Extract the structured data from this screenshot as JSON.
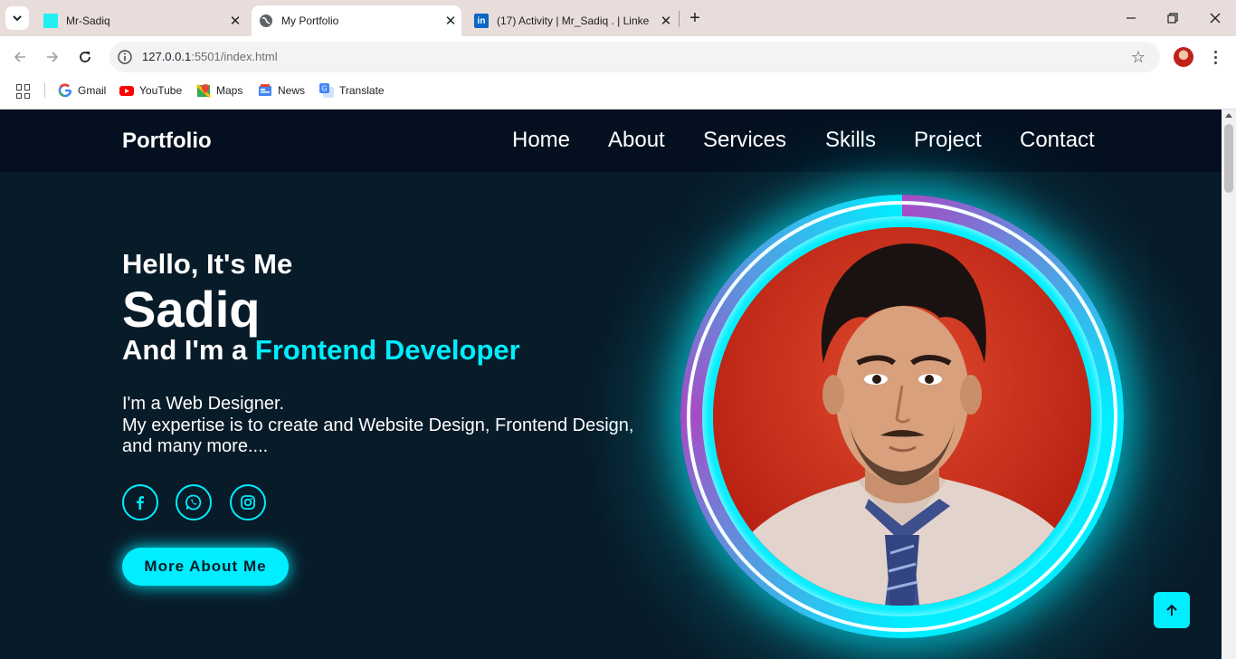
{
  "browser": {
    "tabs": [
      {
        "title": "Mr-Sadiq",
        "icon": "cyan-square-favicon",
        "active": false
      },
      {
        "title": "My Portfolio",
        "icon": "globe-icon",
        "active": true
      },
      {
        "title": "(17) Activity | Mr_Sadiq . | Linke",
        "icon": "linkedin-icon",
        "active": false
      }
    ],
    "new_tab_label": "+",
    "url_host": "127.0.0.1",
    "url_rest": ":5501/index.html",
    "bookmarks": [
      {
        "label": "Gmail",
        "icon": "google-icon"
      },
      {
        "label": "YouTube",
        "icon": "youtube-icon"
      },
      {
        "label": "Maps",
        "icon": "maps-icon"
      },
      {
        "label": "News",
        "icon": "news-icon"
      },
      {
        "label": "Translate",
        "icon": "translate-icon"
      }
    ]
  },
  "site": {
    "logo": "Portfolio",
    "nav": [
      "Home",
      "About",
      "Services",
      "Skills",
      "Project",
      "Contact"
    ],
    "hero": {
      "greeting": "Hello, It's Me",
      "name": "Sadiq",
      "role_prefix": "And I'm a",
      "role": "Frontend Developer",
      "desc_line1": "I'm a Web Designer.",
      "desc_line2": "My expertise is to create and Website Design, Frontend Design, and many more....",
      "social": [
        "facebook-icon",
        "whatsapp-icon",
        "instagram-icon"
      ],
      "button": "More About Me"
    },
    "accent_color": "#00eeff",
    "bg_color": "#081b29"
  }
}
